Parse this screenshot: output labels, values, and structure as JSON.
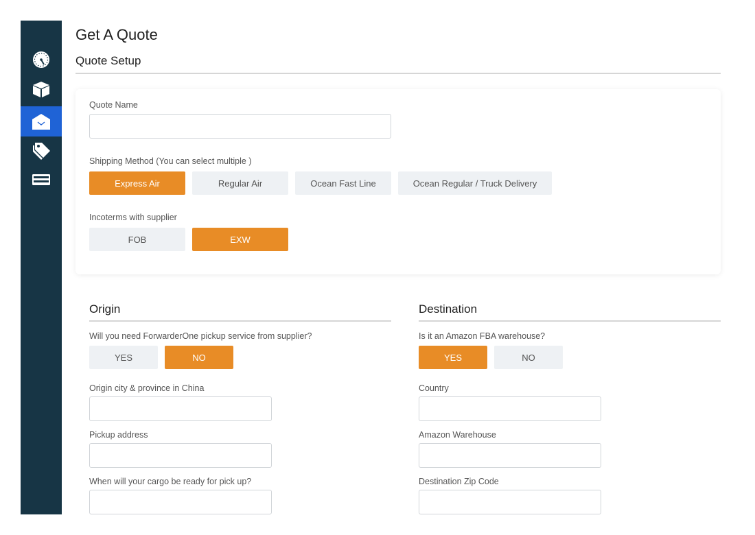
{
  "colors": {
    "sidebar_bg": "#173545",
    "sidebar_active": "#1f63d6",
    "accent": "#e88c26",
    "button_default": "#eef1f4"
  },
  "sidebar": {
    "items": [
      {
        "icon": "speedometer-icon",
        "active": false
      },
      {
        "icon": "box-icon",
        "active": false
      },
      {
        "icon": "envelope-icon",
        "active": true
      },
      {
        "icon": "tags-icon",
        "active": false
      },
      {
        "icon": "credit-card-icon",
        "active": false
      }
    ]
  },
  "header": {
    "title": "Get A Quote",
    "section_title": "Quote Setup"
  },
  "quote_setup": {
    "quote_name_label": "Quote Name",
    "quote_name_value": "",
    "shipping_method_label": "Shipping Method (You can select multiple )",
    "shipping_methods": [
      {
        "label": "Express Air",
        "selected": true
      },
      {
        "label": "Regular Air",
        "selected": false
      },
      {
        "label": "Ocean Fast Line",
        "selected": false
      },
      {
        "label": "Ocean Regular / Truck Delivery",
        "selected": false
      }
    ],
    "incoterms_label": "Incoterms with supplier",
    "incoterms": [
      {
        "label": "FOB",
        "selected": false
      },
      {
        "label": "EXW",
        "selected": true
      }
    ]
  },
  "origin": {
    "title": "Origin",
    "pickup_question": "Will you need ForwarderOne pickup service from supplier?",
    "pickup_options": [
      {
        "label": "YES",
        "selected": false
      },
      {
        "label": "NO",
        "selected": true
      }
    ],
    "city_label": "Origin city & province in China",
    "city_value": "",
    "address_label": "Pickup address",
    "address_value": "",
    "ready_label": "When will your cargo be ready for pick up?",
    "ready_value": ""
  },
  "destination": {
    "title": "Destination",
    "fba_question": "Is it an Amazon FBA warehouse?",
    "fba_options": [
      {
        "label": "YES",
        "selected": true
      },
      {
        "label": "NO",
        "selected": false
      }
    ],
    "country_label": "Country",
    "country_value": "",
    "warehouse_label": "Amazon Warehouse",
    "warehouse_value": "",
    "zip_label": "Destination Zip Code",
    "zip_value": ""
  }
}
